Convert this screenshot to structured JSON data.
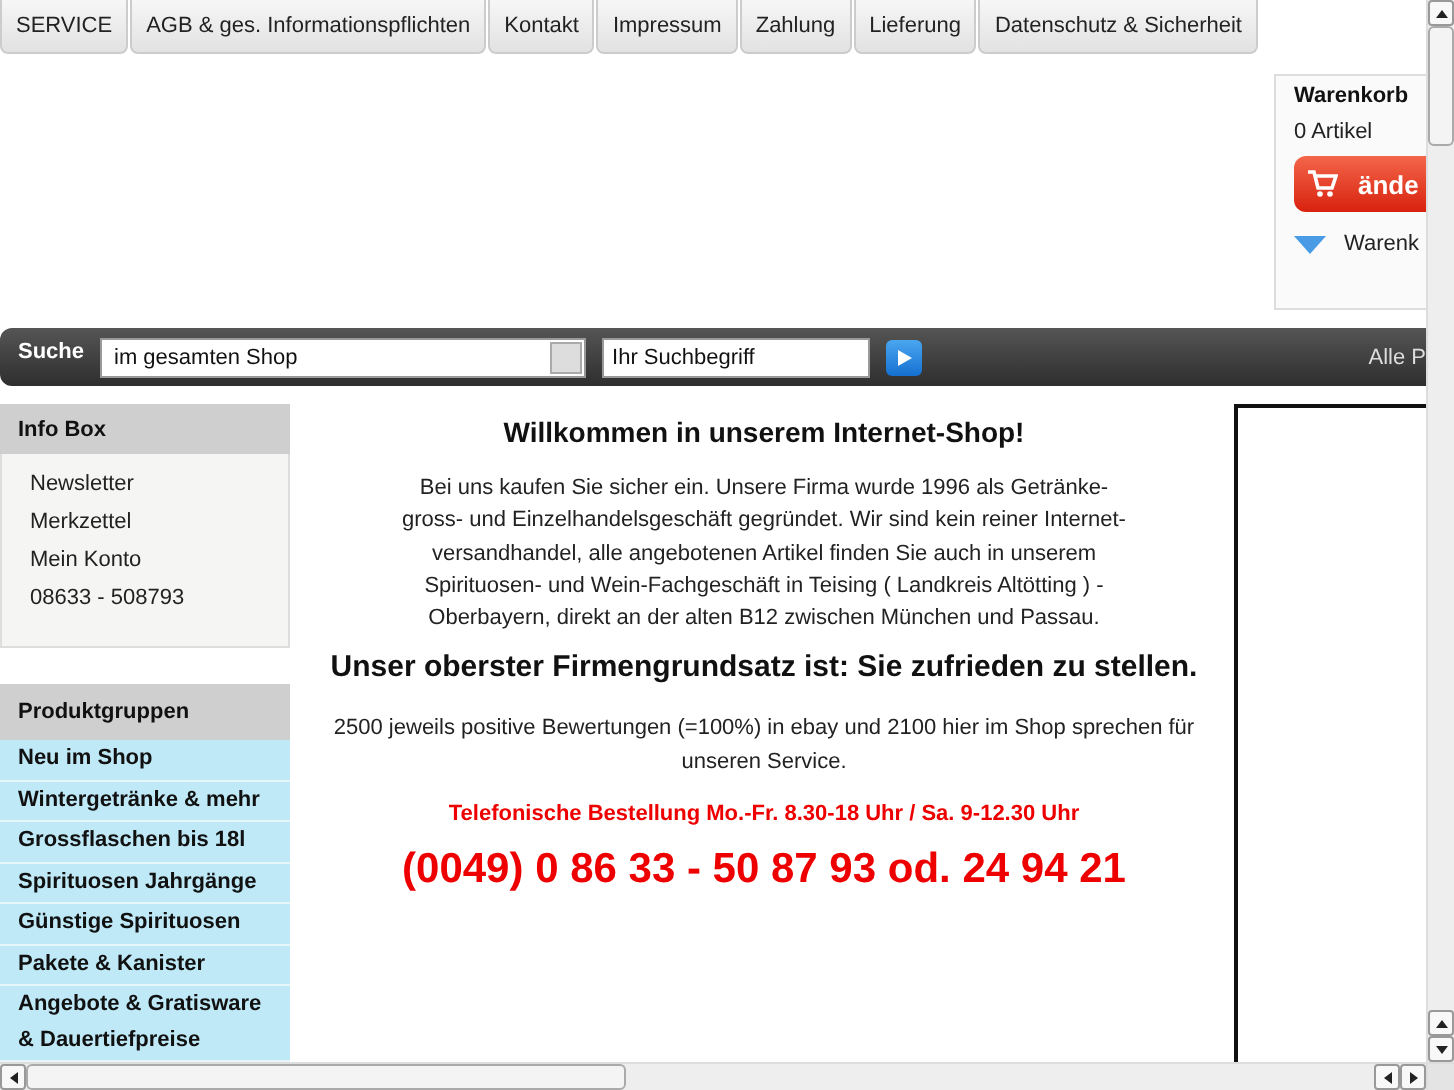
{
  "nav_tabs": [
    "SERVICE",
    "AGB & ges. Informationspflichten",
    "Kontakt",
    "Impressum",
    "Zahlung",
    "Lieferung",
    "Datenschutz & Sicherheit"
  ],
  "cart": {
    "title": "Warenkorb",
    "count": "0 Artikel",
    "button": "ände",
    "link": "Warenk"
  },
  "search": {
    "label": "Suche",
    "scope": "im gesamten Shop",
    "placeholder": "Ihr Suchbegriff",
    "right_link": "Alle P"
  },
  "info_box": {
    "title": "Info Box",
    "items": [
      "Newsletter",
      "Merkzettel",
      "Mein Konto",
      "08633 - 508793"
    ]
  },
  "product_groups": {
    "title": "Produktgruppen",
    "items": [
      "Neu im Shop",
      "Wintergetränke & mehr",
      "Grossflaschen bis 18l",
      "Spirituosen Jahrgänge",
      "Günstige Spirituosen",
      "Pakete & Kanister",
      "Angebote & Gratisware & Dauertiefpreise"
    ]
  },
  "main": {
    "heading": "Willkommen in unserem Internet-Shop!",
    "intro": "Bei uns kaufen Sie sicher ein. Unsere Firma wurde 1996 als Getränke-gross- und Einzelhandelsgeschäft gegründet. Wir sind kein reiner Internet-versandhandel, alle angebotenen Artikel finden Sie auch in unserem Spirituosen- und Wein-Fachgeschäft in Teising ( Landkreis Altötting ) - Oberbayern, direkt an der alten B12 zwischen München und Passau.",
    "motto": "Unser oberster Firmengrundsatz ist: Sie zufrieden zu stellen.",
    "reviews": "2500 jeweils positive Bewertungen (=100%) in ebay und 2100 hier im Shop sprechen für unseren Service.",
    "hours": "Telefonische Bestellung Mo.-Fr. 8.30-18 Uhr / Sa. 9-12.30 Uhr",
    "phone": "(0049) 0 86 33 - 50 87 93 od. 24 94 21"
  }
}
